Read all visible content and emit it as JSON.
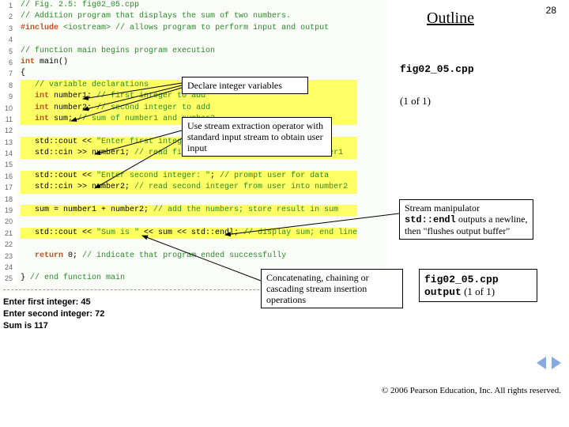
{
  "header": {
    "outline": "Outline",
    "page_number": "28"
  },
  "sidebar": {
    "filename": "fig02_05.cpp",
    "pager": "(1 of 1)"
  },
  "code_lines": [
    "// Fig. 2.5: fig02_05.cpp",
    "// Addition program that displays the sum of two numbers.",
    "#include <iostream> // allows program to perform input and output",
    "",
    "// function main begins program execution",
    "int main()",
    "{",
    "   // variable declarations",
    "   int number1; // first integer to add",
    "   int number2; // second integer to add",
    "   int sum; // sum of number1 and number2",
    "",
    "   std::cout << \"Enter first integer: \"; // prompt user for data",
    "   std::cin >> number1; // read first integer from user into number1",
    "",
    "   std::cout << \"Enter second integer: \"; // prompt user for data",
    "   std::cin >> number2; // read second integer from user into number2",
    "",
    "   sum = number1 + number2; // add the numbers; store result in sum",
    "",
    "   std::cout << \"Sum is \" << sum << std::endl; // display sum; end line",
    "",
    "   return 0; // indicate that program ended successfully",
    "",
    "} // end function main"
  ],
  "output": {
    "l1": "Enter first integer: 45",
    "l2": "Enter second integer: 72",
    "l3": "Sum is 117"
  },
  "callouts": {
    "declare": "Declare integer variables",
    "stream_in": "Use stream extraction operator with standard input stream to obtain user input",
    "endl_a": "Stream manipulator ",
    "endl_b": "std::endl",
    "endl_c": " outputs a newline, then \"flushes output buffer\"",
    "concat": "Concatenating, chaining or cascading stream insertion operations"
  },
  "sidebox": {
    "file": "fig02_05.cpp",
    "out": "output",
    "pager": " (1 of 1)"
  },
  "footer": {
    "copyright": "© 2006 Pearson Education, Inc. All rights reserved."
  }
}
